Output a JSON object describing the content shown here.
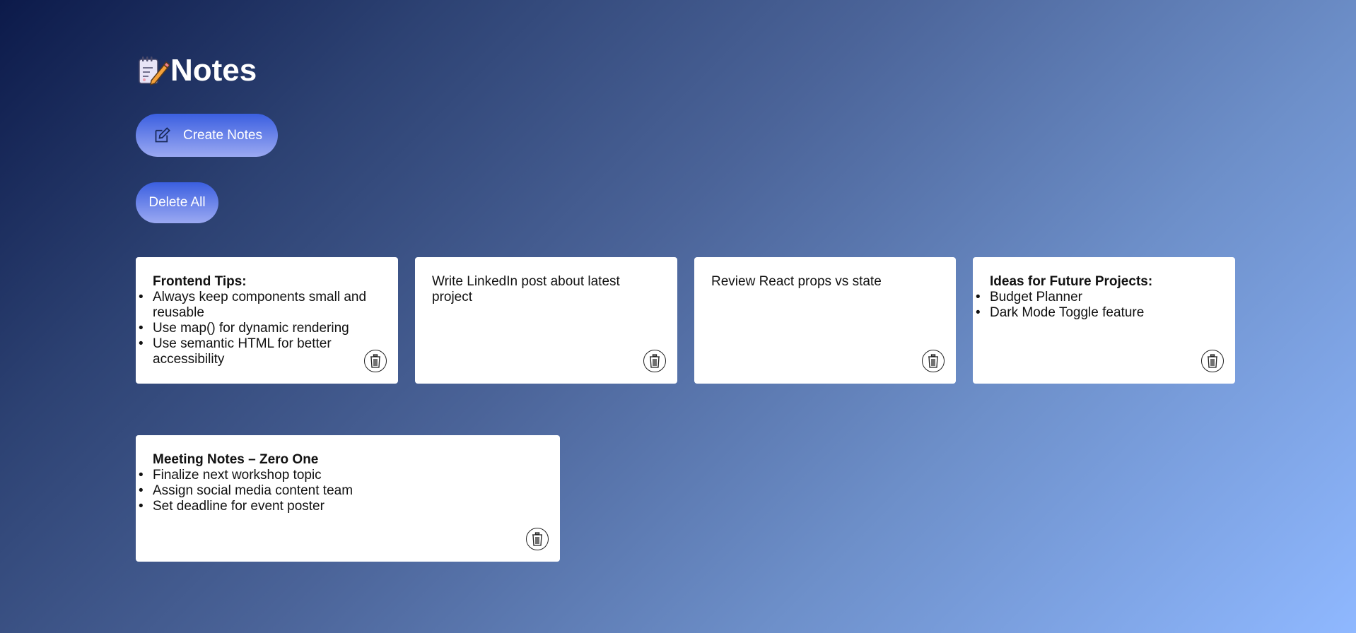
{
  "app": {
    "title": "Notes",
    "logo_icon": "notepad-pencil-icon"
  },
  "toolbar": {
    "create_label": "Create Notes",
    "create_icon": "edit-icon",
    "delete_all_label": "Delete All"
  },
  "colors": {
    "button_gradient_start": "#3b5fe0",
    "button_gradient_end": "#9ba9f2"
  },
  "notes": [
    {
      "heading": "Frontend Tips:",
      "items": [
        "Always keep components small and reusable",
        "Use map() for dynamic rendering",
        "Use semantic HTML for better accessibility"
      ]
    },
    {
      "text": "Write LinkedIn post about latest project"
    },
    {
      "text": "Review React props vs state"
    },
    {
      "heading": "Ideas for Future Projects:",
      "items": [
        "Budget Planner",
        "Dark Mode Toggle feature"
      ]
    },
    {
      "heading": "Meeting Notes – Zero One",
      "items": [
        "Finalize next workshop topic",
        "Assign social media content team",
        "Set deadline for event poster"
      ]
    }
  ]
}
